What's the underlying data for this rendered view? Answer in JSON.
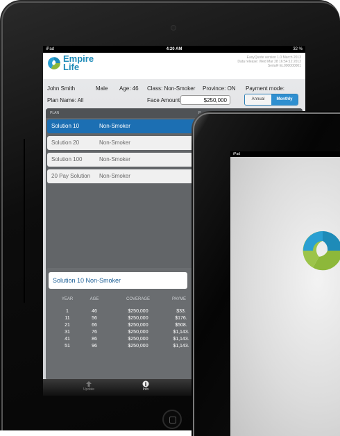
{
  "status": {
    "device": "iPad",
    "time": "4:20 AM",
    "battery": "32 %"
  },
  "header": {
    "brand_line1": "Empire",
    "brand_line2": "Life",
    "version_line1": "EasyQuote version 1.0 March 2012",
    "version_line2": "Data release: Wed Mar 28 16:54:12 2012",
    "version_line3": "Serial# EL000000001"
  },
  "client": {
    "name": "John Smith",
    "gender": "Male",
    "age": "Age: 46",
    "class": "Class: Non-Smoker",
    "province": "Province: ON",
    "plan_name": "Plan Name: All",
    "face_amount_label": "Face Amount:",
    "face_amount_value": "$250,000"
  },
  "payment": {
    "label": "Payment mode:",
    "annual": "Annual",
    "monthly": "Monthly"
  },
  "plan_list": {
    "header_plan": "PLAN",
    "header_right": "P",
    "rows": [
      {
        "name": "Solution 10",
        "class": "Non-Smoker",
        "selected": true
      },
      {
        "name": "Solution 20",
        "class": "Non-Smoker",
        "selected": false
      },
      {
        "name": "Solution 100",
        "class": "Non-Smoker",
        "selected": false
      },
      {
        "name": "20 Pay Solution",
        "class": "Non-Smoker",
        "selected": false
      }
    ]
  },
  "result": {
    "title": "Solution 10 Non-Smoker",
    "columns": [
      "YEAR",
      "AGE",
      "COVERAGE",
      "PAYME"
    ],
    "rows": [
      {
        "year": "1",
        "age": "46",
        "coverage": "$250,000",
        "payment": "$33."
      },
      {
        "year": "11",
        "age": "56",
        "coverage": "$250,000",
        "payment": "$176."
      },
      {
        "year": "21",
        "age": "66",
        "coverage": "$250,000",
        "payment": "$508."
      },
      {
        "year": "31",
        "age": "76",
        "coverage": "$250,000",
        "payment": "$1,143."
      },
      {
        "year": "41",
        "age": "86",
        "coverage": "$250,000",
        "payment": "$1,143."
      },
      {
        "year": "51",
        "age": "96",
        "coverage": "$250,000",
        "payment": "$1,143."
      }
    ]
  },
  "tabbar": {
    "update": "Update",
    "info": "Info"
  },
  "front": {
    "status": "iPad"
  },
  "colors": {
    "brand_blue": "#1e8bb8",
    "brand_green": "#8db83a",
    "selected_row": "#1c6fb3"
  }
}
